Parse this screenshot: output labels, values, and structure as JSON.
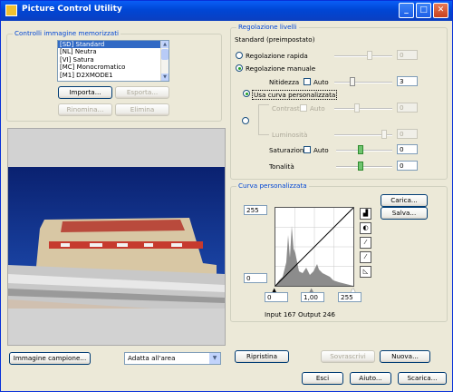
{
  "window": {
    "title": "Picture Control Utility"
  },
  "left": {
    "group_title": "Controlli immagine memorizzati",
    "list_items": [
      {
        "label": "[SD] Standard",
        "selected": true
      },
      {
        "label": "[NL] Neutra",
        "selected": false
      },
      {
        "label": "[VI] Satura",
        "selected": false
      },
      {
        "label": "[MC] Monocromatico",
        "selected": false
      },
      {
        "label": "[M1] D2XMODE1",
        "selected": false
      }
    ],
    "import_label": "Importa...",
    "export_label": "Esporta...",
    "rename_label": "Rinomina...",
    "delete_label": "Elimina",
    "sample_image_label": "Immagine campione...",
    "fit_select_value": "Adatta all'area"
  },
  "adjust": {
    "group_title": "Regolazione livelli",
    "base": "Standard (preimpostato)",
    "quick_label": "Regolazione rapida",
    "quick_value": "0",
    "manual_label": "Regolazione manuale",
    "sharpness_label": "Nitidezza",
    "auto_label": "Auto",
    "sharpness_value": "3",
    "custom_curve_label": "Usa curva personalizzata",
    "contrast_label": "Contrasto",
    "contrast_value": "0",
    "brightness_label": "Luminosità",
    "brightness_value": "0",
    "saturation_label": "Saturazione",
    "saturation_value": "0",
    "hue_label": "Tonalità",
    "hue_value": "0"
  },
  "curve": {
    "group_title": "Curva personalizzata",
    "load_label": "Carica...",
    "save_label": "Salva...",
    "output_max": "255",
    "output_min": "0",
    "input_min": "0",
    "gamma": "1,00",
    "input_max": "255",
    "input_readout": "Input  167",
    "output_readout": "Output  246"
  },
  "footer": {
    "reset_label": "Ripristina",
    "overwrite_label": "Sovrascrivi",
    "new_label": "Nuova...",
    "exit_label": "Esci",
    "help_label": "Aiuto...",
    "download_label": "Scarica..."
  }
}
